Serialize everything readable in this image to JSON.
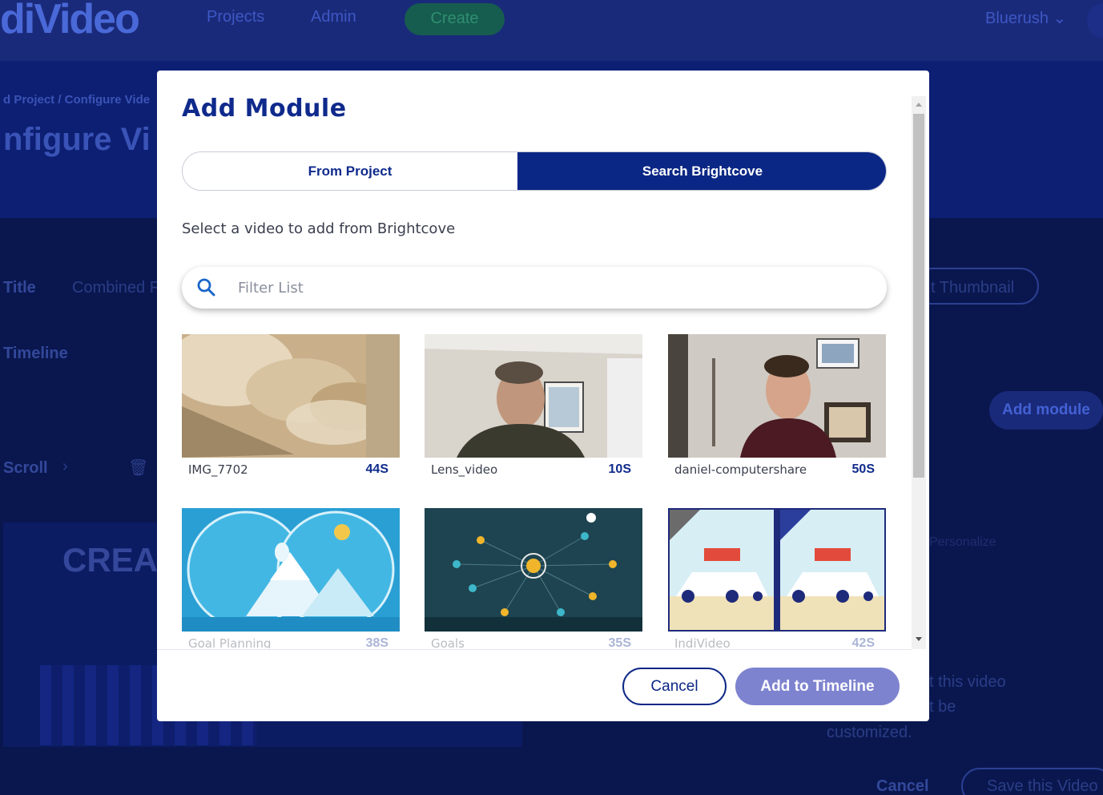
{
  "background": {
    "logo": "diVideo",
    "nav": [
      "Projects",
      "Admin",
      "Create"
    ],
    "account": "Bluerush",
    "breadcrumb": "d Project  /  Configure Vide",
    "page_title": "nfigure Vi",
    "field_title": "Title",
    "field_value": "Combined F",
    "thumbnail_button": "t Thumbnail",
    "timeline_label": "Timeline",
    "add_module": "Add module",
    "scroll_label": "Scroll",
    "create_banner": "CREA",
    "personalize": "Personalize",
    "note_line1": "t this video",
    "note_line2": "t be",
    "note_line3": "customized.",
    "footer_cancel": "Cancel",
    "footer_save": "Save this Video"
  },
  "modal": {
    "title": "Add Module",
    "tabs": [
      {
        "label": "From Project",
        "active": false
      },
      {
        "label": "Search Brightcove",
        "active": true
      }
    ],
    "subtitle": "Select a video to add from Brightcove",
    "search": {
      "placeholder": "Filter List",
      "value": ""
    },
    "videos": [
      {
        "name": "IMG_7702",
        "duration": "44S",
        "thumb": "blurry-pet"
      },
      {
        "name": "Lens_video",
        "duration": "10S",
        "thumb": "man-in-room"
      },
      {
        "name": "daniel-computershare",
        "duration": "50S",
        "thumb": "man-in-office"
      },
      {
        "name": "Goal Planning",
        "duration": "38S",
        "thumb": "mountain-illustration"
      },
      {
        "name": "Goals",
        "duration": "35S",
        "thumb": "network-illustration"
      },
      {
        "name": "IndiVideo",
        "duration": "42S",
        "thumb": "delivery-truck-illustration"
      }
    ],
    "cancel_label": "Cancel",
    "add_label": "Add to Timeline"
  },
  "colors": {
    "primary": "#0b2785",
    "title": "#0f2a8c",
    "add_button": "#7e83cf",
    "overlay": "#0b1a5e"
  }
}
